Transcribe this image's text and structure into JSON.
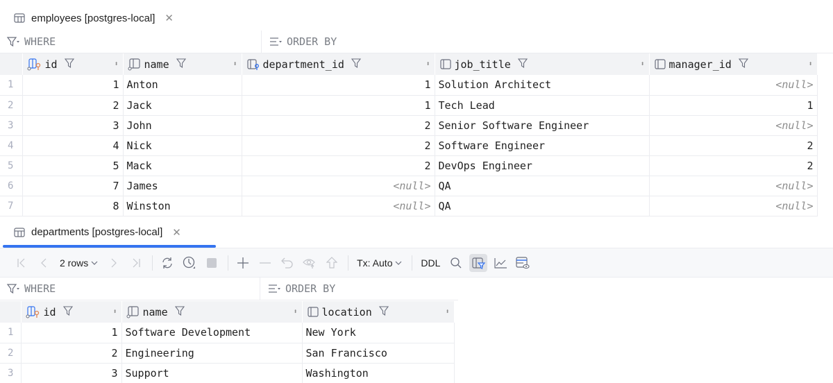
{
  "employees": {
    "tab_title": "employees [postgres-local]",
    "where_label": "WHERE",
    "order_by_label": "ORDER BY",
    "columns": [
      {
        "name": "id",
        "icon": "primary-key-column-icon"
      },
      {
        "name": "name",
        "icon": "column-icon"
      },
      {
        "name": "department_id",
        "icon": "foreign-key-column-icon"
      },
      {
        "name": "job_title",
        "icon": "column-icon"
      },
      {
        "name": "manager_id",
        "icon": "column-icon"
      }
    ],
    "rows": [
      {
        "num": "1",
        "id": "1",
        "name": "Anton",
        "department_id": "1",
        "job_title": "Solution Architect",
        "manager_id": "<null>"
      },
      {
        "num": "2",
        "id": "2",
        "name": "Jack",
        "department_id": "1",
        "job_title": "Tech Lead",
        "manager_id": "1"
      },
      {
        "num": "3",
        "id": "3",
        "name": "John",
        "department_id": "2",
        "job_title": "Senior Software Engineer",
        "manager_id": "<null>"
      },
      {
        "num": "4",
        "id": "4",
        "name": "Nick",
        "department_id": "2",
        "job_title": "Software Engineer",
        "manager_id": "2"
      },
      {
        "num": "5",
        "id": "5",
        "name": "Mack",
        "department_id": "2",
        "job_title": "DevOps Engineer",
        "manager_id": "2"
      },
      {
        "num": "6",
        "id": "7",
        "name": "James",
        "department_id": "<null>",
        "job_title": "QA",
        "manager_id": "<null>"
      },
      {
        "num": "7",
        "id": "8",
        "name": "Winston",
        "department_id": "<null>",
        "job_title": "QA",
        "manager_id": "<null>"
      }
    ]
  },
  "departments": {
    "tab_title": "departments [postgres-local]",
    "toolbar": {
      "rows_label": "2 rows",
      "tx_label": "Tx: Auto",
      "ddl_label": "DDL"
    },
    "where_label": "WHERE",
    "order_by_label": "ORDER BY",
    "columns": [
      {
        "name": "id",
        "icon": "primary-key-column-icon"
      },
      {
        "name": "name",
        "icon": "column-icon"
      },
      {
        "name": "location",
        "icon": "column-icon"
      }
    ],
    "rows": [
      {
        "num": "1",
        "id": "1",
        "name": "Software Development",
        "location": "New York"
      },
      {
        "num": "2",
        "id": "2",
        "name": "Engineering",
        "location": "San Francisco"
      },
      {
        "num": "3",
        "id": "3",
        "name": "Support",
        "location": "Washington"
      }
    ]
  },
  "colors": {
    "accent": "#3574f0",
    "header_bg": "#f2f3f5",
    "null_text": "#8c8c8c",
    "key_orange": "#e08855"
  }
}
